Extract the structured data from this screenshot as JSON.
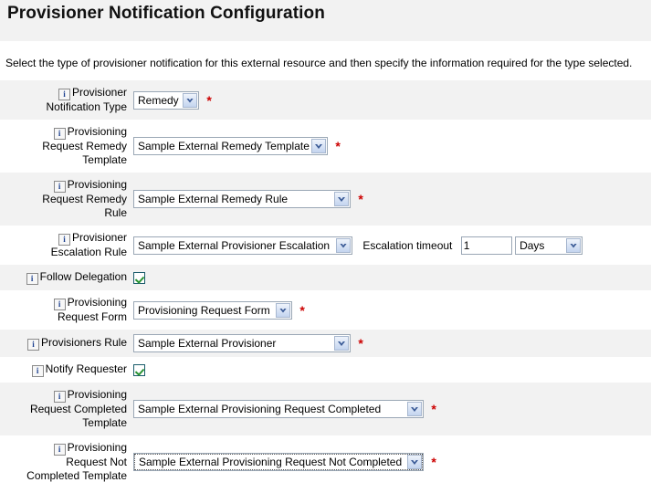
{
  "header": {
    "title": "Provisioner Notification Configuration"
  },
  "intro": {
    "text": "Select the type of provisioner notification for this external resource and then specify the information required for the type selected."
  },
  "icons": {
    "info": "i",
    "info_name": "info-icon",
    "chevron_down": "chevron-down-icon",
    "check": "check-icon"
  },
  "required_marker": "*",
  "colors": {
    "header_bg": "#f2f2f2",
    "row_alt_bg": "#f2f2f2",
    "row_bg": "#ffffff",
    "required_red": "#cc0000",
    "info_blue": "#1b3f8f",
    "check_green": "#2a9434",
    "select_border": "#9aa7b5",
    "arrow_blue": "#3a5a96"
  },
  "rows": [
    {
      "id": "provisioner-notification-type",
      "label_lines": [
        "Provisioner",
        "Notification Type"
      ],
      "control": "select",
      "value": "Remedy",
      "required": true
    },
    {
      "id": "provisioning-request-remedy-template",
      "label_lines": [
        "Provisioning",
        "Request Remedy",
        "Template"
      ],
      "control": "select",
      "value": "Sample External Remedy Template",
      "required": true
    },
    {
      "id": "provisioning-request-remedy-rule",
      "label_lines": [
        "Provisioning",
        "Request Remedy",
        "Rule"
      ],
      "control": "select",
      "value": "Sample External Remedy Rule",
      "required": true
    },
    {
      "id": "provisioner-escalation-rule",
      "label_lines": [
        "Provisioner",
        "Escalation Rule"
      ],
      "control": "select",
      "value": "Sample External Provisioner Escalation",
      "required": false,
      "extra": {
        "timeout_label": "Escalation timeout",
        "timeout_value": "1",
        "unit_value": "Days"
      }
    },
    {
      "id": "follow-delegation",
      "label_lines": [
        "Follow Delegation"
      ],
      "control": "checkbox",
      "checked": true,
      "required": false
    },
    {
      "id": "provisioning-request-form",
      "label_lines": [
        "Provisioning",
        "Request Form"
      ],
      "control": "select",
      "value": "Provisioning Request Form",
      "required": true
    },
    {
      "id": "provisioners-rule",
      "label_lines": [
        "Provisioners Rule"
      ],
      "control": "select",
      "value": "Sample External Provisioner",
      "required": true
    },
    {
      "id": "notify-requester",
      "label_lines": [
        "Notify Requester"
      ],
      "control": "checkbox",
      "checked": true,
      "required": false
    },
    {
      "id": "provisioning-request-completed-template",
      "label_lines": [
        "Provisioning",
        "Request Completed",
        "Template"
      ],
      "control": "select",
      "value": "Sample External Provisioning Request Completed",
      "required": true
    },
    {
      "id": "provisioning-request-not-completed-template",
      "label_lines": [
        "Provisioning",
        "Request Not",
        "Completed Template"
      ],
      "control": "select",
      "value": "Sample External Provisioning Request Not Completed",
      "required": true,
      "focused": true
    }
  ]
}
